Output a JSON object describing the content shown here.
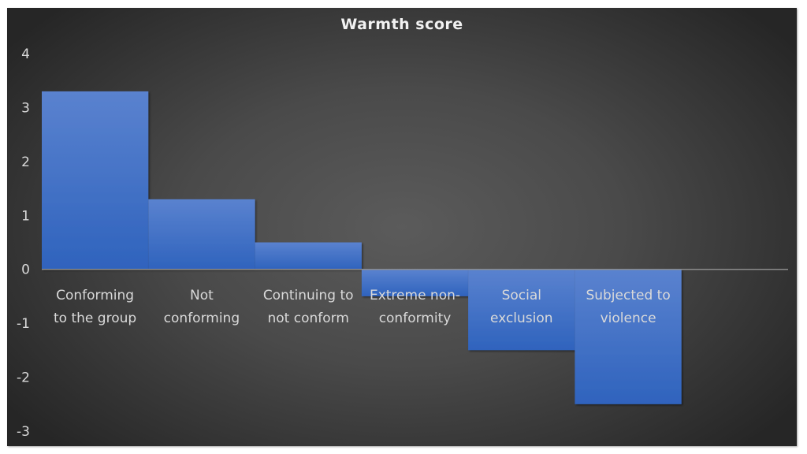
{
  "chart_data": {
    "type": "bar",
    "title": "Warmth score",
    "xlabel": "",
    "ylabel": "",
    "categories": [
      [
        "Conforming",
        "to the group"
      ],
      [
        "Not",
        "conforming"
      ],
      [
        "Continuing to",
        "not conform"
      ],
      [
        "Extreme non-",
        "conformity"
      ],
      [
        "Social",
        "exclusion"
      ],
      [
        "Subjected to",
        "violence"
      ]
    ],
    "series": [
      {
        "name": "Warmth score",
        "values": [
          3.3,
          1.3,
          0.5,
          -0.5,
          -1.5,
          -2.5
        ],
        "color_top": "#5a82cf",
        "color_bottom": "#2f63bd"
      }
    ],
    "ylim": [
      -3,
      4
    ],
    "yticks": [
      4,
      3,
      2,
      1,
      0,
      -1,
      -2,
      -3
    ],
    "category_slots": 7,
    "gap_width": 0,
    "grid": false,
    "legend": "none",
    "colors": {
      "background_center": "#5b5b5b",
      "background_edge": "#262626",
      "axis_line": "#8c8c8c",
      "text": "#d9d9d9",
      "title": "#f2f2f2"
    }
  }
}
